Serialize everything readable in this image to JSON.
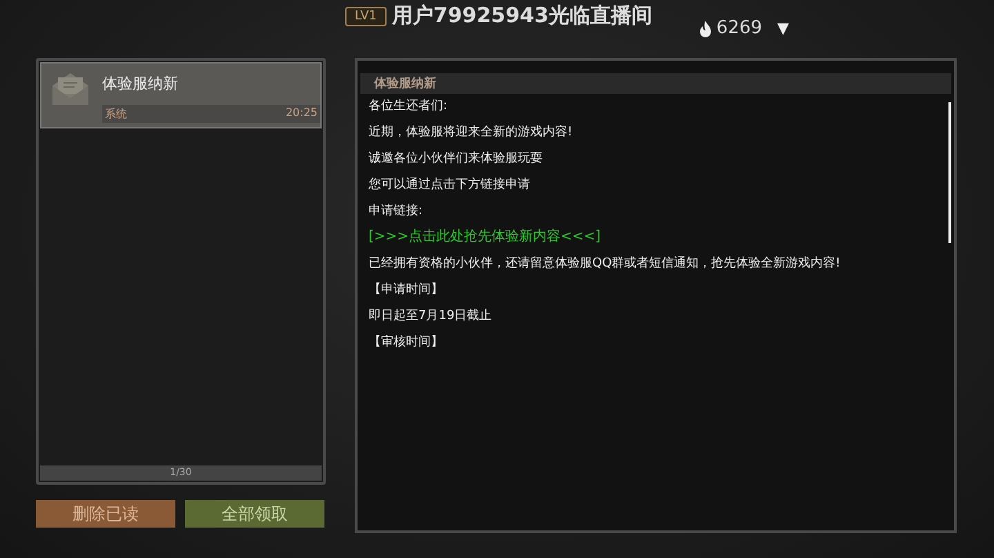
{
  "header": {
    "level_badge": "LV1",
    "title": "用户79925943光临直播间",
    "heat": "6269",
    "dropdown_icon": "▼"
  },
  "mail_list": {
    "items": [
      {
        "title": "体验服纳新",
        "sender": "系统",
        "time": "20:25",
        "selected": true
      }
    ],
    "pager": "1/30"
  },
  "buttons": [
    {
      "label": "删除已读",
      "kind": "delete"
    },
    {
      "label": "全部领取",
      "kind": "claim"
    }
  ],
  "mail": {
    "title": "体验服纳新",
    "lines": [
      {
        "text": "各位生还者们:",
        "kind": "plain"
      },
      {
        "text": "近期，体验服将迎来全新的游戏内容!",
        "kind": "plain"
      },
      {
        "text": "诚邀各位小伙伴们来体验服玩耍",
        "kind": "plain"
      },
      {
        "text": "您可以通过点击下方链接申请",
        "kind": "plain"
      },
      {
        "text": "申请链接:",
        "kind": "plain"
      },
      {
        "text": "[>>>点击此处抢先体验新内容<<<]",
        "kind": "link"
      },
      {
        "text": "已经拥有资格的小伙伴，还请留意体验服QQ群或者短信通知，抢先体验全新游戏内容!",
        "kind": "plain"
      },
      {
        "text": "【申请时间】",
        "kind": "plain"
      },
      {
        "text": "即日起至7月19日截止",
        "kind": "plain"
      },
      {
        "text": "【审核时间】",
        "kind": "plain"
      }
    ]
  }
}
